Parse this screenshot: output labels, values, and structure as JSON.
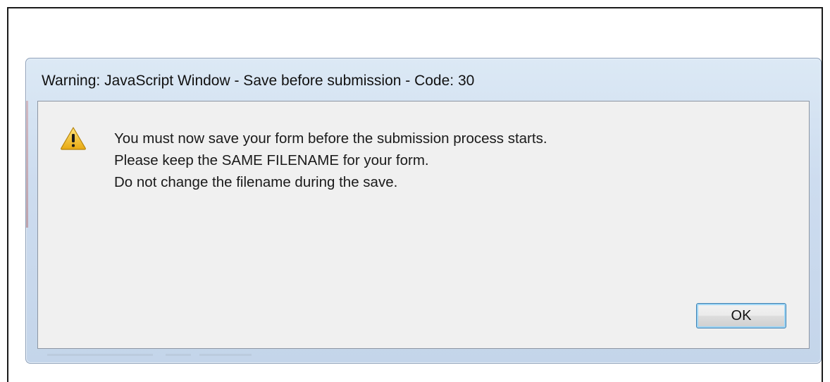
{
  "dialog": {
    "title": "Warning: JavaScript Window - Save before submission - Code: 30",
    "icon": "warning-icon",
    "message_lines": [
      "You must now save your form before the submission process starts.",
      "Please keep the SAME FILENAME for your form.",
      "Do not change the filename during the save."
    ],
    "ok_label": "OK"
  },
  "colors": {
    "warning_fill": "#f5c518",
    "button_focus": "#3c7fb1",
    "title_bar": "#cddcef"
  }
}
